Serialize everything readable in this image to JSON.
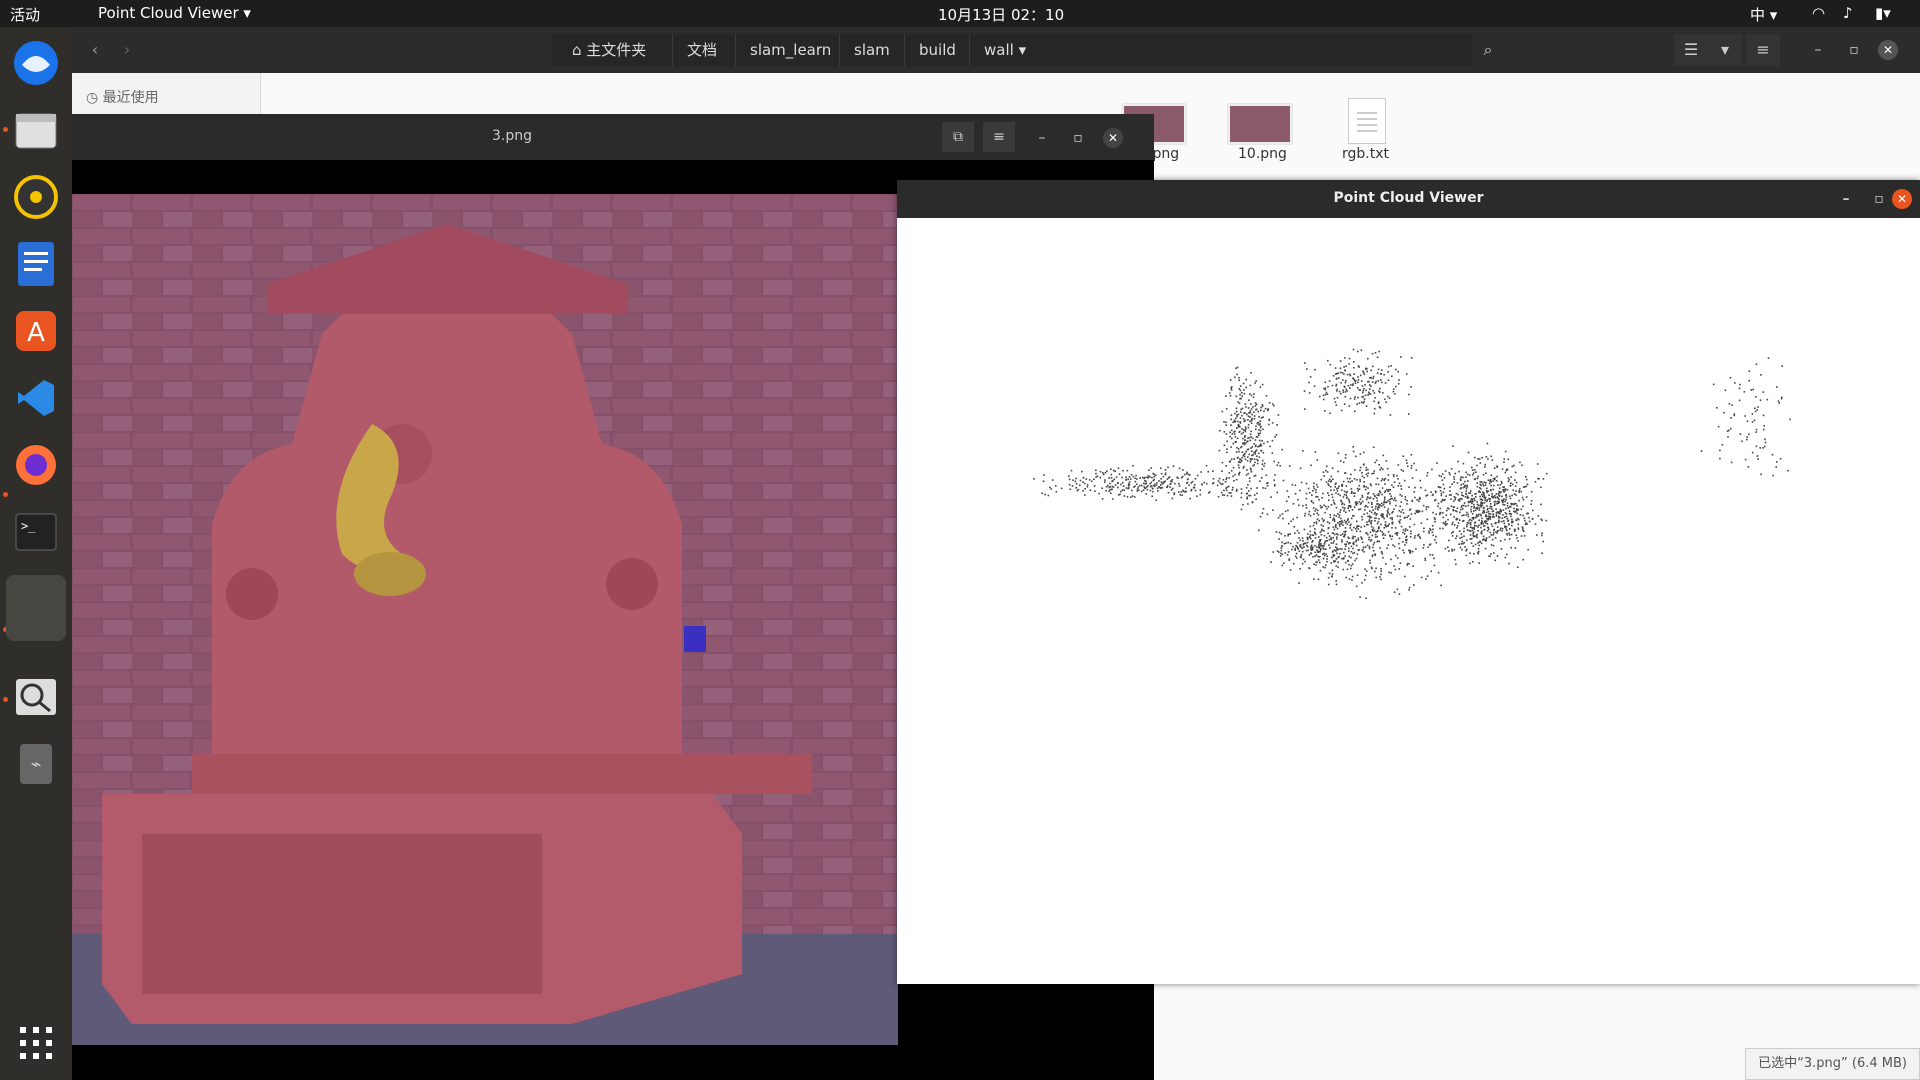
{
  "topbar": {
    "activities": "活动",
    "app_menu": "Point Cloud Viewer",
    "clock": "10月13日  02：10",
    "input_method": "中"
  },
  "dock": {
    "items": [
      "thunderbird-icon",
      "files-icon",
      "rhythmbox-icon",
      "writer-icon",
      "software-icon",
      "vscode-icon",
      "firefox-icon",
      "terminal-icon",
      "blank-app-icon",
      "magnifier-icon",
      "usb-icon"
    ],
    "show_apps": "app-grid-icon"
  },
  "file_manager": {
    "path": [
      "主文件夹",
      "文档",
      "slam_learn",
      "slam",
      "build",
      "wall"
    ],
    "sidebar": {
      "recent": "最近使用"
    },
    "files": [
      {
        "name": ".png"
      },
      {
        "name": "10.png"
      },
      {
        "name": "rgb.txt"
      }
    ],
    "status": "已选中“3.png” (6.4 MB)"
  },
  "image_viewer": {
    "title": "3.png"
  },
  "point_cloud_viewer": {
    "title": "Point Cloud Viewer"
  },
  "colors": {
    "accent": "#e95420",
    "topbar": "#1d1d1d",
    "dock": "#2f2e2b"
  }
}
